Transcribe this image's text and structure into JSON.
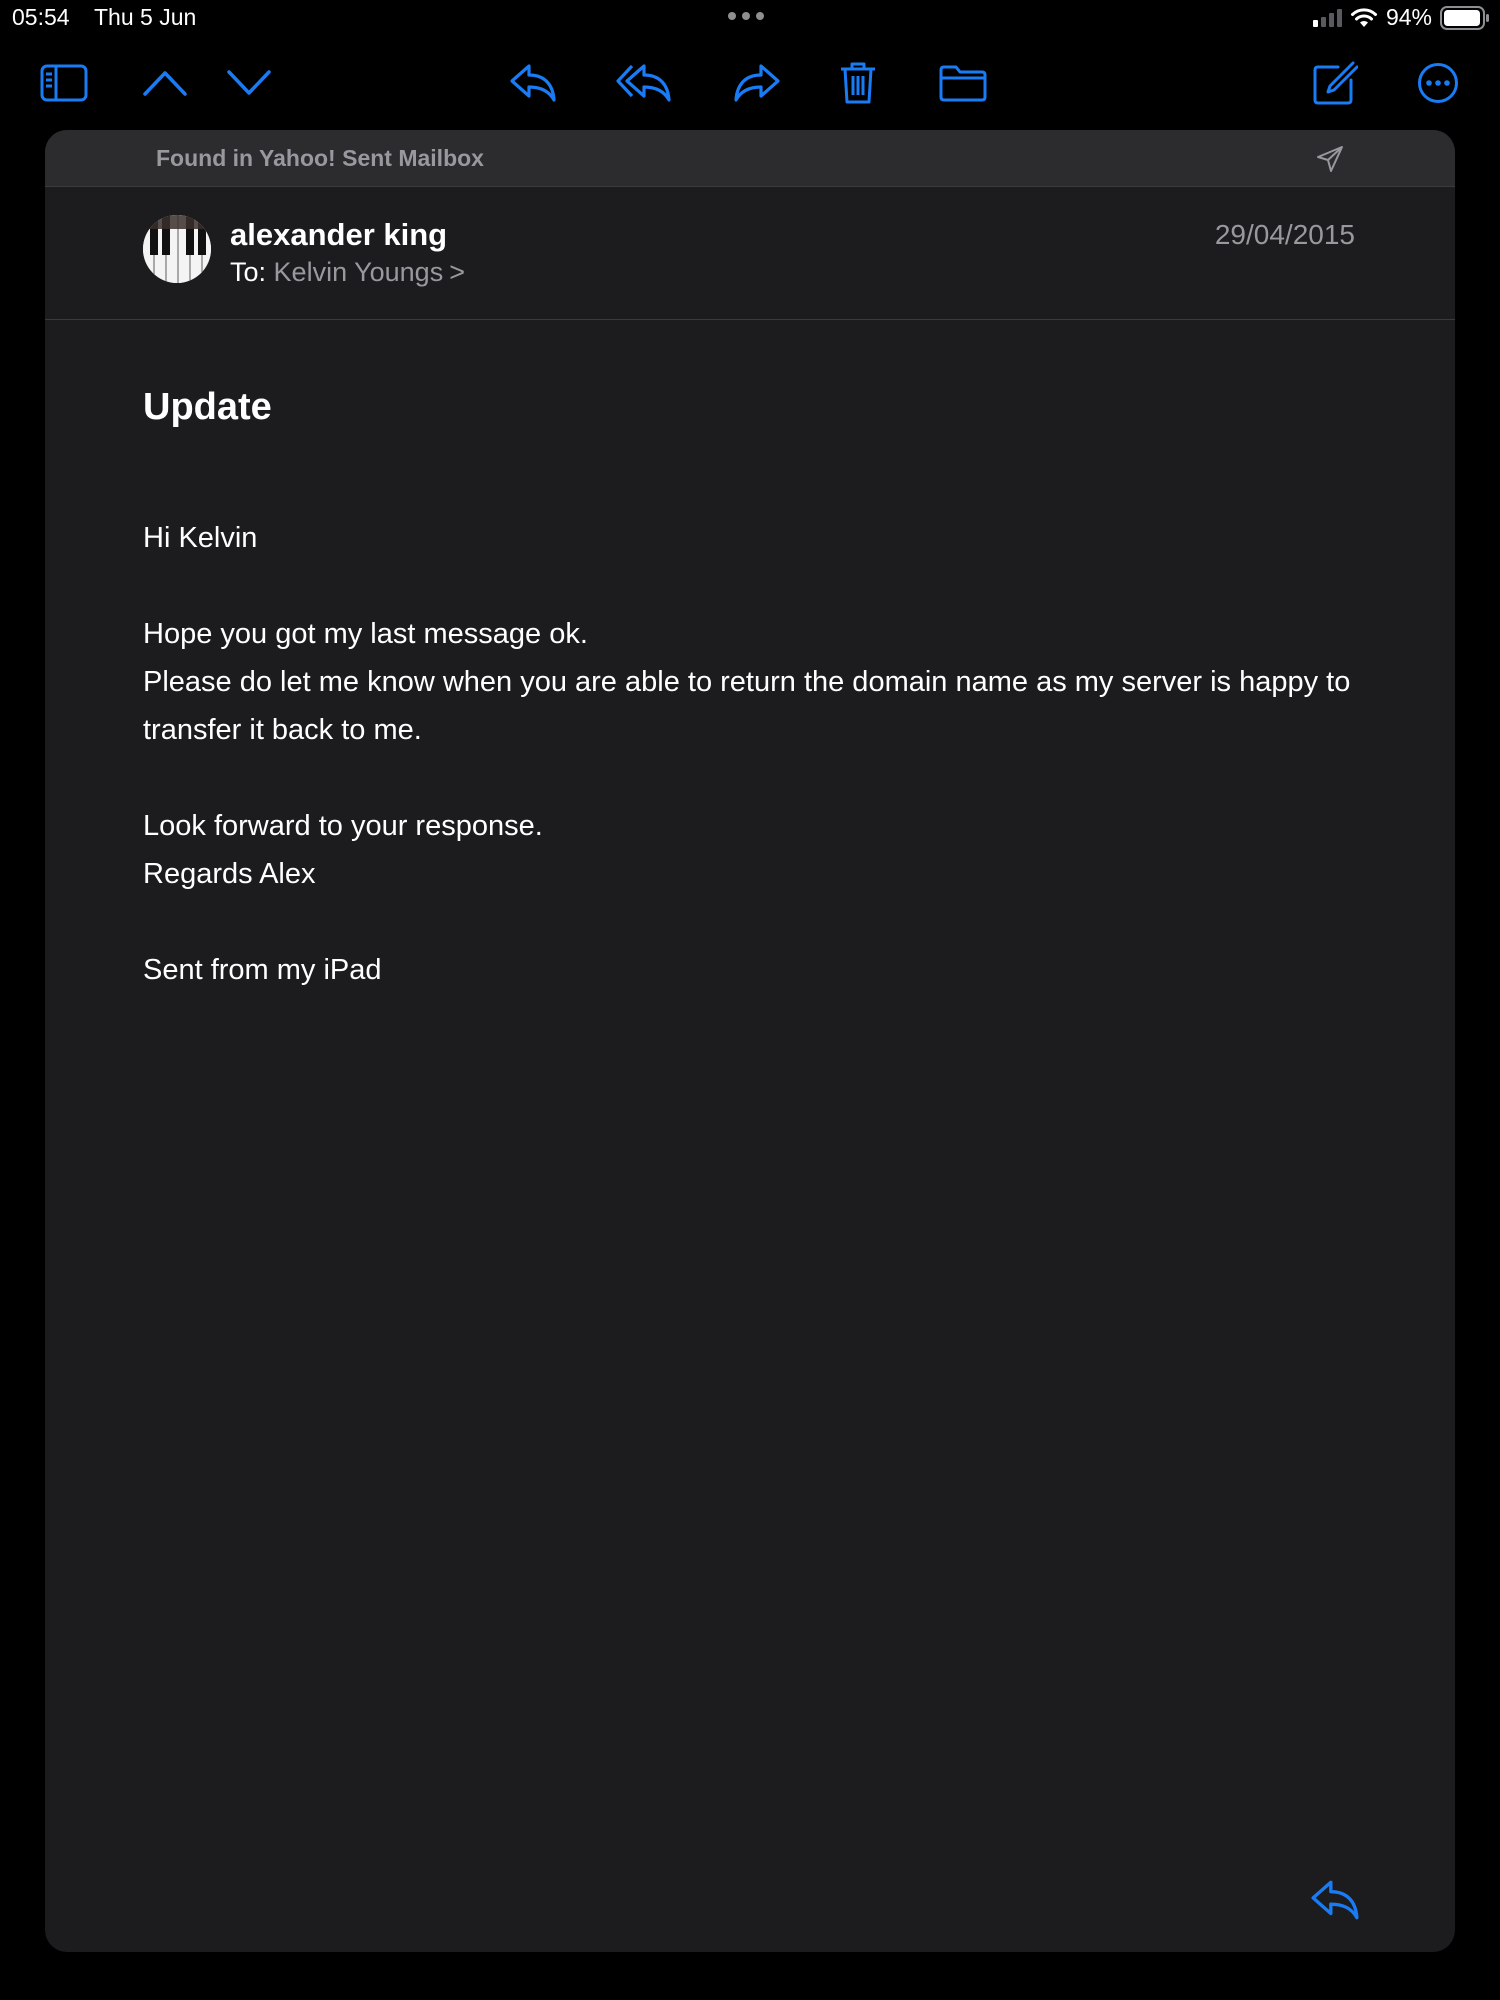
{
  "status_bar": {
    "time": "05:54",
    "date": "Thu 5 Jun",
    "battery": "94%"
  },
  "toolbar": {
    "icons": [
      "sidebar-icon",
      "chevron-up-icon",
      "chevron-down-icon",
      "reply-icon",
      "reply-all-icon",
      "forward-icon",
      "trash-icon",
      "folder-icon",
      "compose-icon",
      "more-icon"
    ]
  },
  "banner": {
    "text": "Found in Yahoo! Sent Mailbox"
  },
  "message": {
    "sender": "alexander king",
    "to_label": "To:",
    "to_name": "Kelvin Youngs",
    "to_chevron": ">",
    "date": "29/04/2015",
    "subject": "Update",
    "body": "Hi Kelvin\n\nHope you got my last message ok.\nPlease do let me know when you are able to return the domain name as my server is happy to transfer it back to me.\n\nLook forward to your response.\nRegards Alex\n\nSent from my iPad"
  },
  "colors": {
    "accent": "#1a7cf5",
    "card_bg": "#1c1c1e",
    "secondary_text": "#98989f"
  }
}
